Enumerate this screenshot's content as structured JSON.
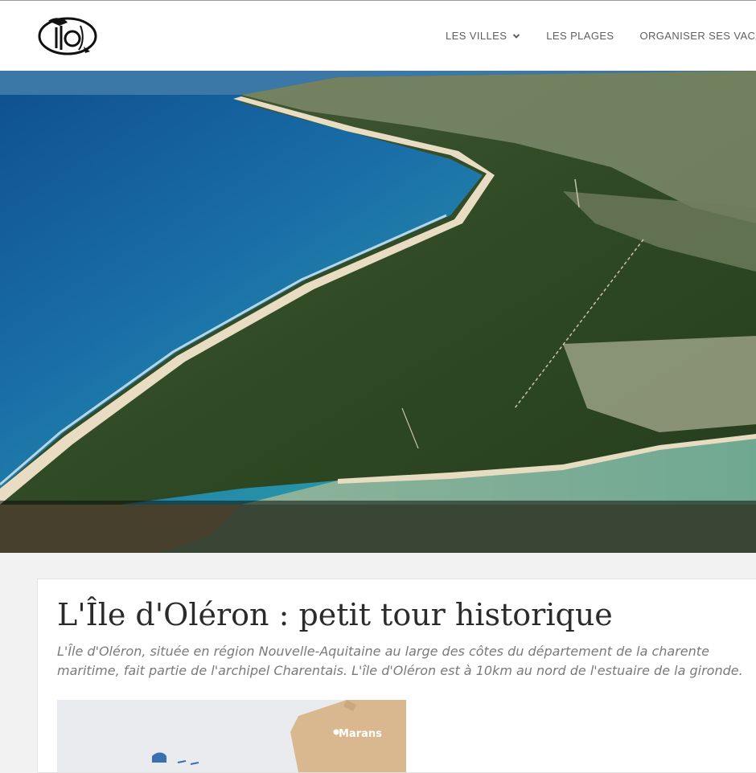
{
  "header": {
    "logo_icon": "oleron-logo-icon",
    "nav": [
      {
        "label": "LES VILLES",
        "icon": "chevron-down-icon"
      },
      {
        "label": "LES PLAGES"
      },
      {
        "label": "ORGANISER SES VACANCES"
      }
    ]
  },
  "hero": {
    "image": "aerial-coastline-photo"
  },
  "article": {
    "title": "L'Île d'Oléron : petit tour historique",
    "lead": "L'Île d'Oléron, située en région Nouvelle-Aquitaine au large des côtes du département de la charente maritime, fait partie de l'archipel Charentais. L'île d'Oléron est à 10km au nord de l'estuaire de la gironde.",
    "map": {
      "city_label": "Marans"
    }
  },
  "colors": {
    "header_bg": "#ffffff",
    "nav_text": "#5f5f5f",
    "page_bg": "#f2f2f2",
    "title_text": "#2b2b2b",
    "lead_text": "#7a7a7a",
    "map_land": "#d9b890"
  }
}
